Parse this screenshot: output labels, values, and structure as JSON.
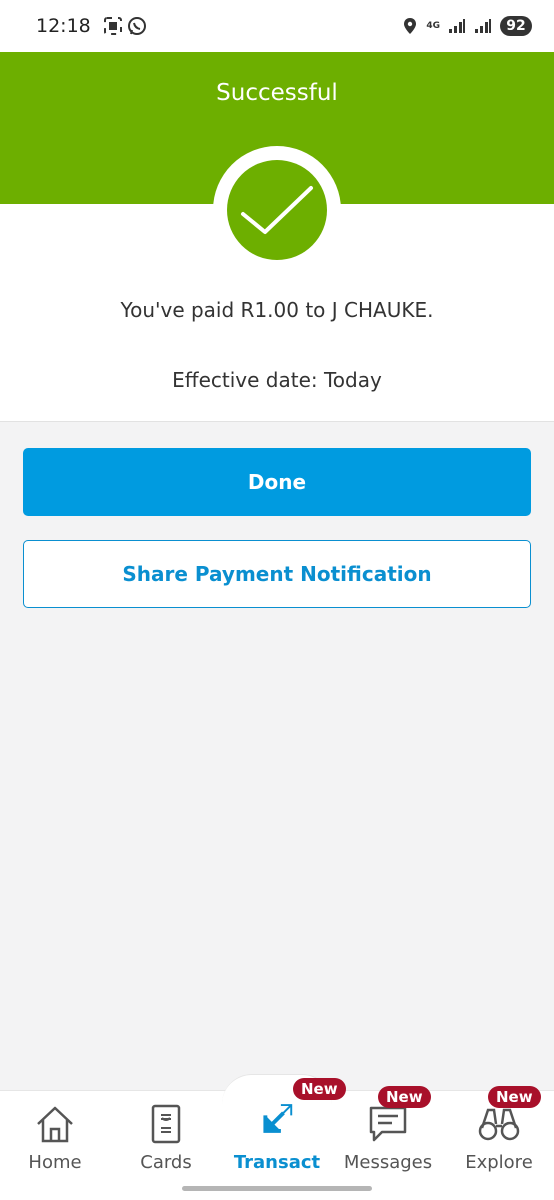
{
  "status_bar": {
    "time": "12:18",
    "network": "4G",
    "battery": "92",
    "icons": [
      "screenshot-icon",
      "whatsapp-icon",
      "location-icon",
      "signal-icon",
      "signal-icon"
    ]
  },
  "header": {
    "title": "Successful"
  },
  "result": {
    "message": "You've paid R1.00 to J CHAUKE.",
    "effective_date": "Effective date: Today"
  },
  "actions": {
    "done_label": "Done",
    "share_label": "Share Payment Notification"
  },
  "nav": {
    "items": [
      {
        "label": "Home",
        "icon": "home-icon"
      },
      {
        "label": "Cards",
        "icon": "card-icon"
      },
      {
        "label": "Transact",
        "icon": "transfer-arrows-icon",
        "active": true,
        "badge": "New"
      },
      {
        "label": "Messages",
        "icon": "message-icon",
        "badge": "New"
      },
      {
        "label": "Explore",
        "icon": "binoculars-icon",
        "badge": "New"
      }
    ]
  },
  "colors": {
    "brand_green": "#6daf00",
    "primary_blue": "#009be0",
    "badge_red": "#a8102a"
  }
}
